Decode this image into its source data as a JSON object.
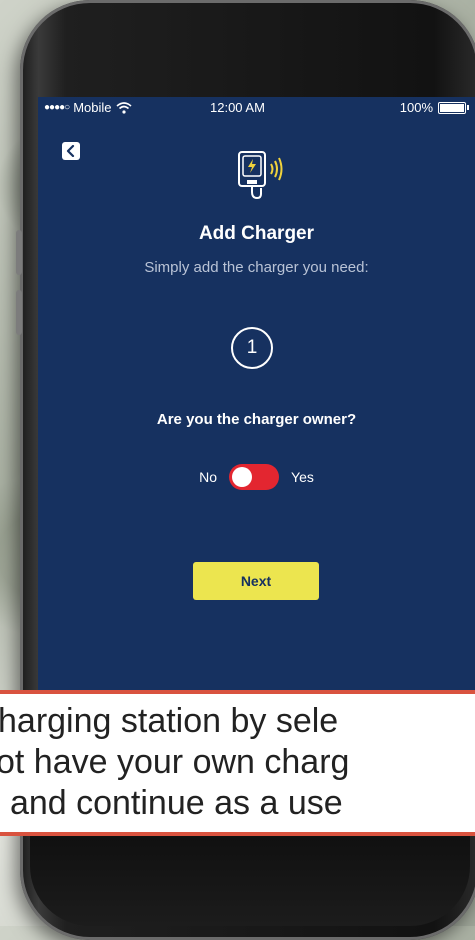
{
  "status_bar": {
    "carrier": "Mobile",
    "time": "12:00 AM",
    "battery": "100%"
  },
  "header": {
    "title": "Add Charger",
    "subtitle": "Simply add the charger you need:"
  },
  "step": {
    "number": "1"
  },
  "question": "Are you the charger owner?",
  "toggle": {
    "off_label": "No",
    "on_label": "Yes",
    "state": "No"
  },
  "buttons": {
    "next_label": "Next"
  },
  "caption": {
    "lines": [
      "harging station by sele",
      "ot have your own charg",
      "' and continue as a use"
    ]
  },
  "colors": {
    "screen_bg": "#163160",
    "button_yellow": "#ece54f",
    "toggle_red": "#e32630",
    "caption_border": "#d9533f"
  },
  "icons": [
    "back-chevron-icon",
    "charger-nfc-icon",
    "wifi-icon",
    "battery-icon"
  ]
}
